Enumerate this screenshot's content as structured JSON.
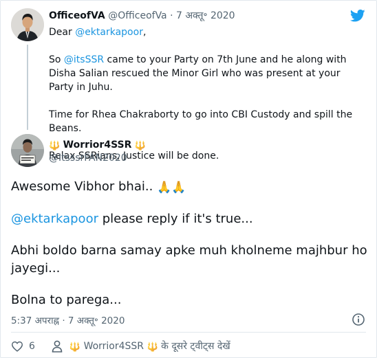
{
  "quoted_tweet": {
    "name": "OfficeofVA",
    "handle": "@OfficeofVa",
    "separator": "·",
    "date": "7 अक्तू॰ 2020",
    "greeting": "Dear",
    "greeting_mention": "@ektarkapoor",
    "greeting_punct": ",",
    "para1_prefix": "So",
    "para1_mention": "@itsSSR",
    "para1_rest": "came to your Party on 7th June and he along with Disha Salian rescued the Minor Girl who was present at your Party in Juhu.",
    "para2": "Time for Rhea Chakraborty to go into CBI Custody and spill the Beans.",
    "para3": "Relax SSRians, Justice will be done."
  },
  "main_tweet": {
    "name": "Worrior4SSR",
    "handle": "@ItsssrFAN2020",
    "line1": "Awesome Vibhor bhai..",
    "line2_mention": "@ektarkapoor",
    "line2_rest": "please reply if it's true...",
    "line3": "Abhi boldo barna samay apke muh kholneme majhbur ho jayegi...",
    "line4": "Bolna to parega...",
    "time": "5:37 अपराह्न",
    "separator": "·",
    "date": "7 अक्तू॰ 2020"
  },
  "actions": {
    "like_count": "6",
    "more_from_name": "Worrior4SSR",
    "more_from_suffix": "के दूसरे ट्वीट्स देखें"
  },
  "icons": {
    "brand": "twitter-bird-icon",
    "info": "info-icon",
    "like": "heart-icon",
    "profile": "person-icon",
    "name_decoration": "trident-emoji",
    "prayer": "folded-hands-emoji"
  },
  "colors": {
    "link": "#1b95e0",
    "muted": "#536471",
    "twitter_blue": "#1da1f2",
    "border": "#e1e8ed"
  }
}
